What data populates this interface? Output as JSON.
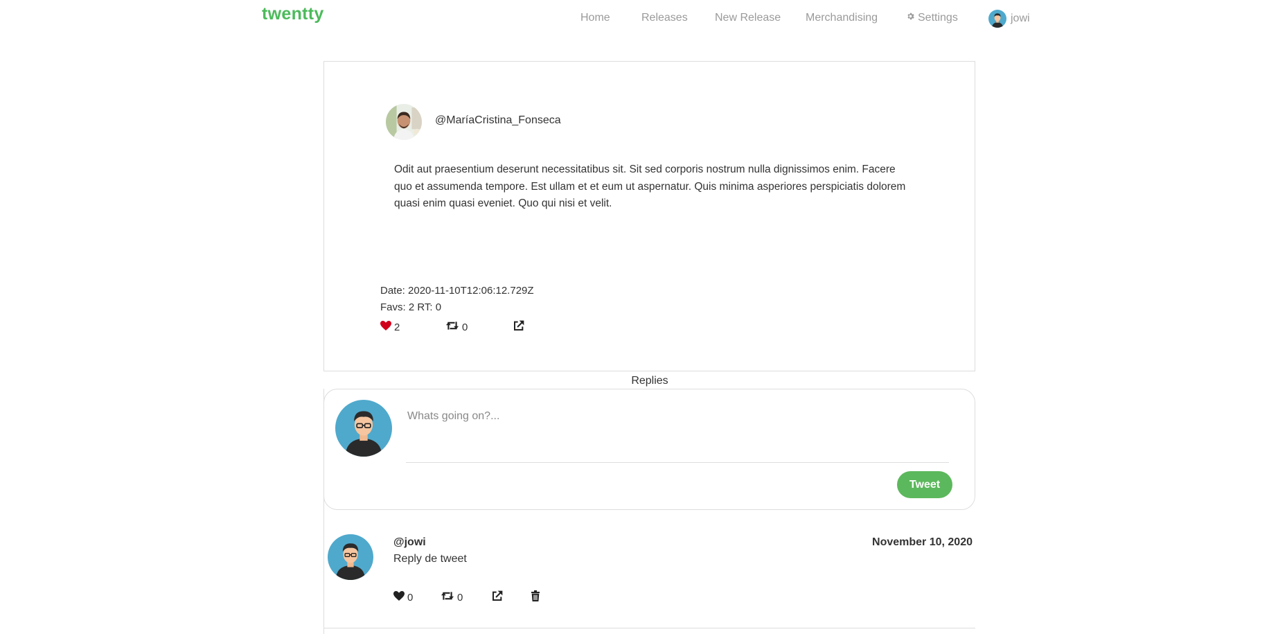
{
  "nav": {
    "brand": "twentty",
    "links": [
      "Home",
      "Releases",
      "New Release",
      "Merchandising"
    ],
    "settings_label": "Settings",
    "user_name": "jowi"
  },
  "tweet": {
    "author_handle": "@MaríaCristina_Fonseca",
    "text": "Odit aut praesentium deserunt necessitatibus sit. Sit sed corporis nostrum nulla dignissimos enim. Facere quo et assumenda tempore. Est ullam et et eum ut aspernatur. Quis minima asperiores perspiciatis dolorem quasi enim quasi eveniet. Quo qui nisi et velit.",
    "date_line": "Date: 2020-11-10T12:06:12.729Z",
    "stats_line": "Favs: 2 RT: 0",
    "fav_count": "2",
    "rt_count": "0"
  },
  "replies_label": "Replies",
  "compose": {
    "placeholder": "Whats going on?...",
    "button_label": "Tweet"
  },
  "replies": [
    {
      "handle": "@jowi",
      "date": "November 10, 2020",
      "text": "Reply de tweet",
      "fav_count": "0",
      "rt_count": "0"
    }
  ],
  "colors": {
    "brand": "#4cba5b",
    "tweet_button": "#5cb85c",
    "heart_active": "#d0021b",
    "avatar_bg": "#4fa9cc"
  }
}
